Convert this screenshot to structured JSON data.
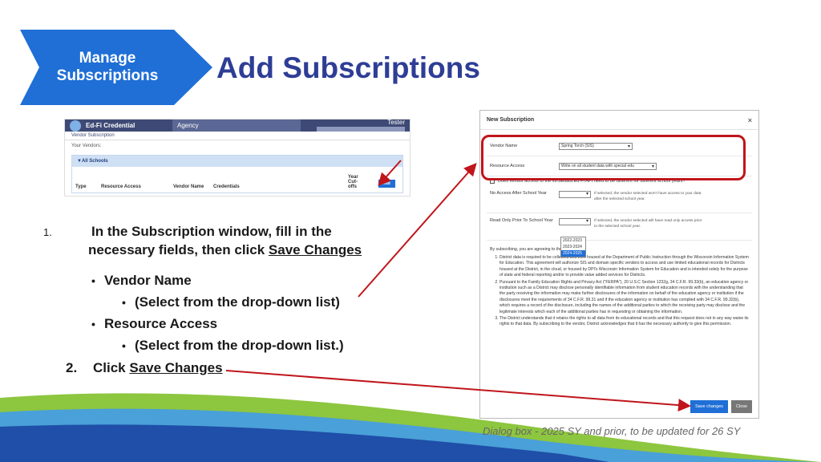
{
  "section_tab": {
    "line1": "Manage",
    "line2": "Subscriptions"
  },
  "title": "Add Subscriptions",
  "app_screenshot": {
    "brand": "Ed-Fi Credential",
    "agency_tab": "Agency",
    "user": "Tester",
    "subtab": "Vendor Subscription",
    "your_vendors": "Your Vendors:",
    "panel_title": "▼All Schools",
    "columns": [
      "Type",
      "Resource Access",
      "Vendor Name",
      "Credentials",
      "Year Cut-offs"
    ],
    "add_button": "Add"
  },
  "instructions": {
    "step1_number": "1.",
    "step1_text_a": "In the Subscription window, fill in the necessary fields, then click ",
    "step1_link": "Save Changes",
    "bullets": [
      {
        "text": "Vendor Name",
        "level": 1
      },
      {
        "text": "(Select from the drop-down list)",
        "level": 2
      },
      {
        "text": "Resource Access",
        "level": 1
      },
      {
        "text": "(Select from the drop-down list.)",
        "level": 2
      }
    ],
    "step2_number": "2.",
    "step2_text": "Click ",
    "step2_link": "Save Changes"
  },
  "dialog": {
    "title": "New Subscription",
    "close": "×",
    "vendor_label": "Vendor Name",
    "vendor_value": "Spring Torch (SIS)",
    "resource_label": "Resource Access",
    "resource_value": "Write on all student data with special edu",
    "different_years_check": "Does vendor access to the WISEdata Ed-Fi API need to be different for different school years?",
    "no_access_label": "No Access After School Year",
    "no_access_hint": "If selected, the vendor selected won't have access to your data after the selected school year.",
    "read_only_label": "Read Only Prior To School Year",
    "read_only_hint": "If selected, the vendor selected will have read only access prior to the selected school year.",
    "year_options": [
      "2022-2023",
      "2023-2024",
      "2024-2025"
    ],
    "selected_year": "2024-2025",
    "agree_text": "By subscribing, you are agreeing to the following:",
    "legal": [
      "District data is required to be collected and then housed at the Department of Public Instruction through the Wisconsin Information System for Education. This agreement will authorize SIS and domain specific vendors to access and use limited educational records for Districts housed at the District, in the cloud, or housed by DPI's Wisconsin Information System for Education and is intended solely for the purpose of state and federal reporting and/or to provide value added services for Districts.",
      "Pursuant to the Family Education Rights and Privacy Act (\"FERPA\"), 20 U.S.C Section 1232g, 34 C.F.R. 99.33(b), an education agency or institution such as a District may disclose personally identifiable information from student education records with the understanding that the party receiving the information may make further disclosures of the information on behalf of the education agency or institution if the disclosures meet the requirements of 34 C.F.R. 99.31 and if the education agency or institution has complied with 34 C.F.R. 99.32(b), which requires a record of the disclosure, including the names of the additional parties to which the receiving party may disclose and the legitimate interests which each of the additional parties has in requesting or obtaining the information.",
      "The District understands that it retains the rights to all data from its educational records and that this request does not in any way waive its rights to that data. By subscribing to the vendor, District acknowledges that it has the necessary authority to give this permission."
    ],
    "save_button": "Save changes",
    "close_button": "Close"
  },
  "caption": "Dialog box - 2025 SY and prior, to be updated for 26 SY",
  "colors": {
    "accent": "#1f6fd6",
    "title": "#2e3d96",
    "highlight": "#c0151b",
    "wave_green": "#8dc63f",
    "wave_blue": "#1f4fa8"
  }
}
